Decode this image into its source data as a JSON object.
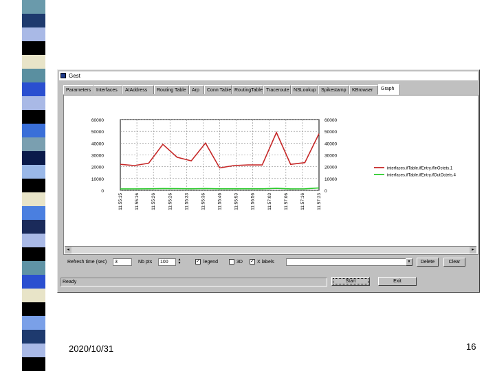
{
  "window": {
    "title": "Gest"
  },
  "tabs": [
    {
      "label": "Parameters"
    },
    {
      "label": "Interfaces"
    },
    {
      "label": "AtAddress"
    },
    {
      "label": "Routing Table"
    },
    {
      "label": "Arp"
    },
    {
      "label": "Conn Table"
    },
    {
      "label": "RoutingTable"
    },
    {
      "label": "Traceroute"
    },
    {
      "label": "NSLookup"
    },
    {
      "label": "Spikestamp"
    },
    {
      "label": "KBrowser"
    },
    {
      "label": "Graph"
    }
  ],
  "colors": {
    "series_in": "#c62828",
    "series_out": "#2ecc2e",
    "window_bg": "#c0c0c0"
  },
  "chart_data": {
    "type": "line",
    "x": [
      "11:55:15",
      "11:55:16",
      "11:55:26",
      "11:55:26",
      "11:55:33",
      "11:55:36",
      "11:55:46",
      "11:55:53",
      "11:56:56",
      "11:57:03",
      "11:57:06",
      "11:57:16",
      "11:57:23"
    ],
    "left_axis": {
      "ticks": [
        "60000",
        "50000",
        "40000",
        "30000",
        "20000",
        "10000",
        "0"
      ],
      "ylim": [
        0,
        60000
      ]
    },
    "right_axis": {
      "ticks": [
        "60000",
        "50000",
        "40000",
        "30000",
        "20000",
        "10000",
        "0"
      ],
      "ylim": [
        0,
        60000
      ]
    },
    "series": [
      {
        "name": "interfaces.ifTable.ifEntry.ifInOctets.1",
        "color": "#c62828",
        "values": [
          22000,
          21000,
          23000,
          39000,
          28000,
          25000,
          40000,
          19000,
          21000,
          21500,
          21500,
          49000,
          22000,
          23500,
          48000
        ]
      },
      {
        "name": "interfaces.ifTable.ifEntry.ifOutOctets.4",
        "color": "#2ecc2e",
        "values": [
          1200,
          1200,
          1300,
          1500,
          1400,
          1300,
          1500,
          1300,
          1300,
          1300,
          1300,
          1700,
          1200,
          1300,
          2000
        ]
      }
    ],
    "grid": true,
    "legend": "right"
  },
  "controls": {
    "refresh_label": "Refresh time (sec)",
    "refresh_value": "3",
    "rows_label": "Nb pts",
    "rows_value": "100",
    "legend_label": "legend",
    "threed_label": "3D",
    "labels_label": "X labels",
    "delete_label": "Delete",
    "clear_label": "Clear",
    "start_label": "Start",
    "exit_label": "Exit"
  },
  "status": {
    "text": "Ready"
  },
  "slide": {
    "date": "2020/10/31",
    "page": "16"
  }
}
